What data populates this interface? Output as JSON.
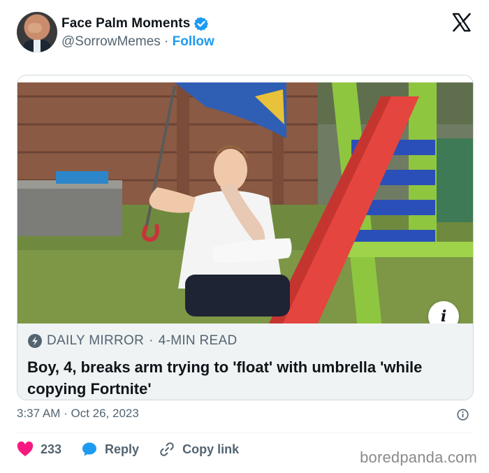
{
  "author": {
    "display_name": "Face Palm Moments",
    "handle": "@SorrowMemes",
    "separator": "·",
    "follow_label": "Follow",
    "verified": true
  },
  "card": {
    "source_label": "DAILY MIRROR",
    "source_sep": "·",
    "read_time": "4-MIN READ",
    "headline": "Boy, 4, breaks arm trying to 'float' with umbrella 'while copying Fortnite'",
    "info_glyph": "i"
  },
  "timestamp": "3:37 AM · Oct 26, 2023",
  "actions": {
    "like_count": "233",
    "reply_label": "Reply",
    "copy_label": "Copy link"
  },
  "watermark": "boredpanda.com",
  "colors": {
    "accent": "#1d9bf0",
    "like": "#f91880",
    "text_primary": "#0f1419",
    "text_secondary": "#536471"
  },
  "icons": [
    "verified-badge-icon",
    "x-logo-icon",
    "bolt-icon",
    "info-icon",
    "heart-icon",
    "reply-bubble-icon",
    "link-icon"
  ]
}
